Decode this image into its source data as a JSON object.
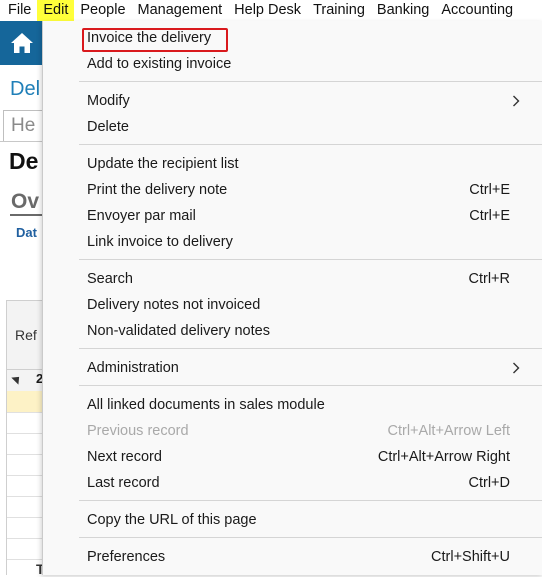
{
  "menubar": {
    "items": [
      "File",
      "Edit",
      "People",
      "Management",
      "Help Desk",
      "Training",
      "Banking",
      "Accounting"
    ]
  },
  "background": {
    "partial_title": "Del",
    "partial_tab": "He",
    "partial_heading": "De",
    "partial_section": "Ov",
    "partial_field": "Dat",
    "partial_column": "Ref",
    "group_prefix": "2",
    "partial_total": "Total"
  },
  "menu": {
    "g1": [
      {
        "label": "Invoice the delivery"
      },
      {
        "label": "Add to existing invoice"
      }
    ],
    "g2": [
      {
        "label": "Modify"
      },
      {
        "label": "Delete"
      }
    ],
    "g3": [
      {
        "label": "Update the recipient list",
        "shortcut": ""
      },
      {
        "label": "Print the delivery note",
        "shortcut": "Ctrl+E"
      },
      {
        "label": "Envoyer par mail",
        "shortcut": "Ctrl+E"
      },
      {
        "label": "Link invoice to delivery",
        "shortcut": ""
      }
    ],
    "g4": [
      {
        "label": "Search",
        "shortcut": "Ctrl+R"
      },
      {
        "label": "Delivery notes not invoiced",
        "shortcut": ""
      },
      {
        "label": "Non-validated delivery notes",
        "shortcut": ""
      }
    ],
    "g5": [
      {
        "label": "Administration"
      }
    ],
    "g6": [
      {
        "label": "All linked documents in sales module",
        "shortcut": ""
      },
      {
        "label": "Previous record",
        "shortcut": "Ctrl+Alt+Arrow Left",
        "disabled": true
      },
      {
        "label": "Next record",
        "shortcut": "Ctrl+Alt+Arrow Right"
      },
      {
        "label": "Last record",
        "shortcut": "Ctrl+D"
      }
    ],
    "g7": [
      {
        "label": "Copy the URL of this page"
      }
    ],
    "g8": [
      {
        "label": "Preferences",
        "shortcut": "Ctrl+Shift+U"
      }
    ]
  },
  "colors": {
    "brand_blue": "#1f7fb8",
    "highlight_yellow": "#ffff3a",
    "annotation_red": "#d9191d"
  }
}
